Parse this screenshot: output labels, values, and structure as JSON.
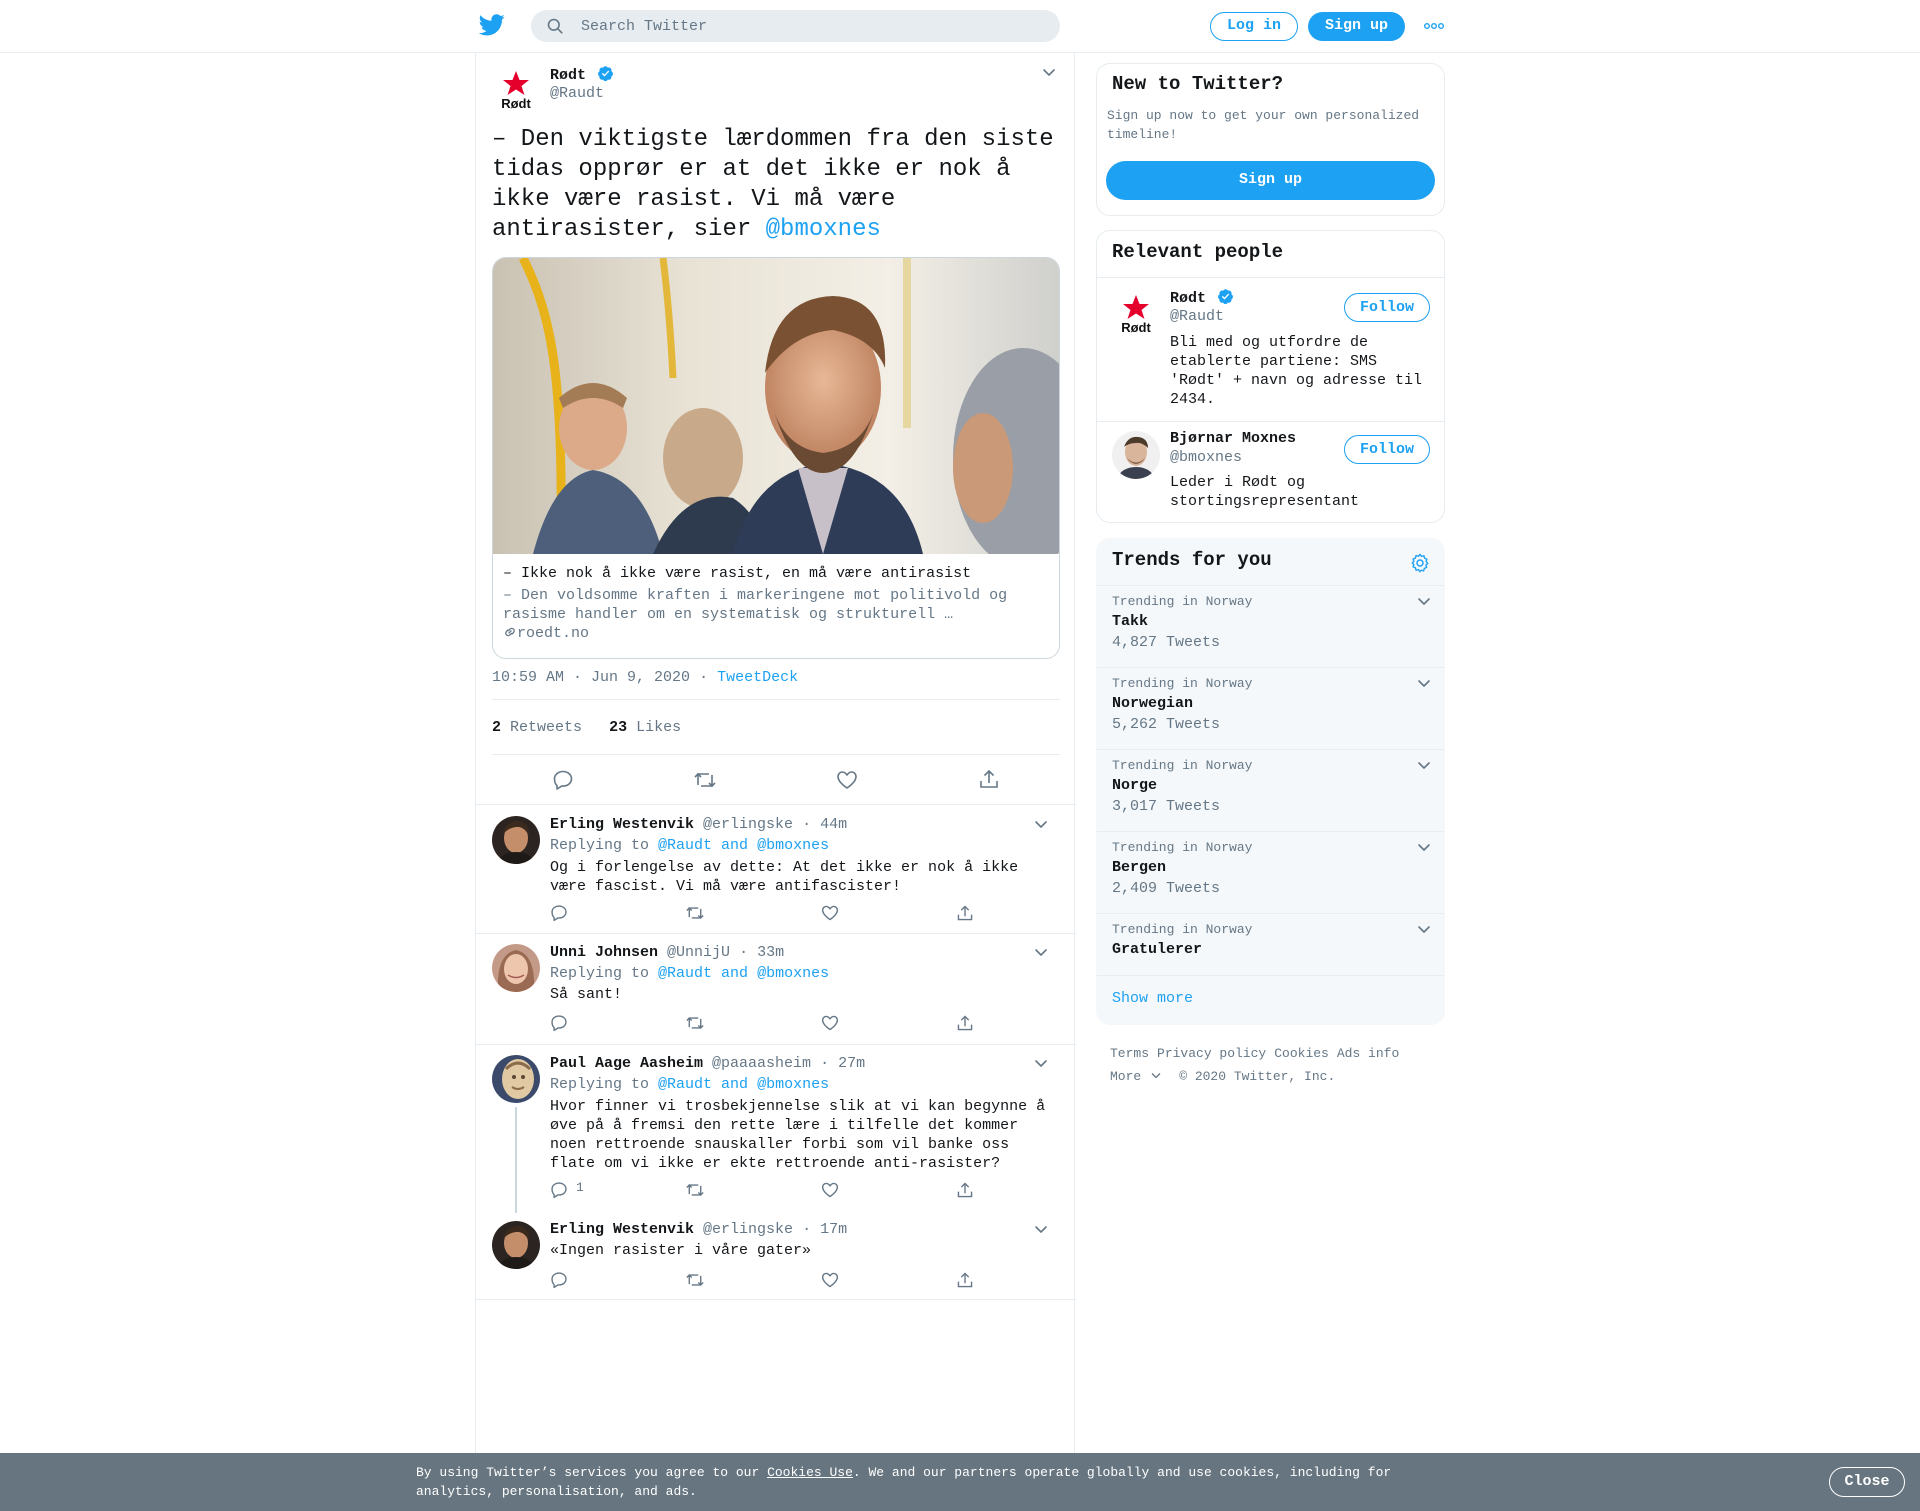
{
  "topbar": {
    "search_placeholder": "Search Twitter",
    "login_label": "Log in",
    "signup_label": "Sign up",
    "more_icon": "more-dots-icon"
  },
  "colors": {
    "accent": "#1da1f2",
    "text": "#14171a",
    "muted": "#657786",
    "border": "#e6ecf0",
    "cookie_bg": "#66757f",
    "rodt_red": "#e5002b"
  },
  "tweet": {
    "author_name": "Rødt",
    "author_handle": "@Raudt",
    "text_before": "– Den viktigste lærdommen fra den siste tidas opprør er at det ikke er nok å ikke være rasist. Vi må være antirasister, sier ",
    "text_mention": "@bmoxnes",
    "card": {
      "title": "– Ikke nok å ikke være rasist, en må være antirasist",
      "description": "– Den voldsomme kraften i markeringene mot politivold og rasisme handler om en systematisk og strukturell …",
      "domain": "roedt.no"
    },
    "time": "10:59 AM · Jun 9, 2020",
    "dot": "·",
    "source": "TweetDeck",
    "retweets_count": "2",
    "retweets_label": "Retweets",
    "likes_count": "23",
    "likes_label": "Likes"
  },
  "replies": [
    {
      "name": "Erling Westenvik",
      "handle": "@erlingske",
      "time": "· 44m",
      "replying_prefix": "Replying to",
      "replying_to": "@Raudt and @bmoxnes",
      "text": "Og i forlengelse av dette: At det ikke er nok å ikke være fascist. Vi må være antifascister!",
      "reply_count": ""
    },
    {
      "name": "Unni Johnsen",
      "handle": "@UnnijU",
      "time": "· 33m",
      "replying_prefix": "Replying to",
      "replying_to": "@Raudt and @bmoxnes",
      "text": "Så sant!",
      "reply_count": ""
    },
    {
      "name": "Paul Aage Aasheim",
      "handle": "@paaaasheim",
      "time": "· 27m",
      "replying_prefix": "Replying to",
      "replying_to": "@Raudt and @bmoxnes",
      "text": "Hvor finner vi trosbekjennelse slik at vi kan begynne å øve på å fremsi den rette lære i tilfelle det kommer noen rettroende snauskaller forbi som vil banke oss flate om vi ikke er ekte rettroende anti-rasister?",
      "reply_count": "1"
    },
    {
      "name": "Erling Westenvik",
      "handle": "@erlingske",
      "time": "· 17m",
      "text": "«Ingen rasister i våre gater»",
      "reply_count": ""
    }
  ],
  "sidebar": {
    "new_title": "New to Twitter?",
    "new_sub": "Sign up now to get your own personalized timeline!",
    "new_signup": "Sign up",
    "relevant_title": "Relevant people",
    "people": [
      {
        "name": "Rødt",
        "handle": "@Raudt",
        "bio": "Bli med og utfordre de etablerte partiene: SMS 'Rødt' + navn og adresse til 2434.",
        "follow": "Follow"
      },
      {
        "name": "Bjørnar Moxnes",
        "handle": "@bmoxnes",
        "bio": "Leder i Rødt og stortingsrepresentant",
        "follow": "Follow"
      }
    ],
    "trends_title": "Trends for you",
    "trends": [
      {
        "context": "Trending in Norway",
        "name": "Takk",
        "count": "4,827 Tweets"
      },
      {
        "context": "Trending in Norway",
        "name": "Norwegian",
        "count": "5,262 Tweets"
      },
      {
        "context": "Trending in Norway",
        "name": "Norge",
        "count": "3,017 Tweets"
      },
      {
        "context": "Trending in Norway",
        "name": "Bergen",
        "count": "2,409 Tweets"
      },
      {
        "context": "Trending in Norway",
        "name": "Gratulerer",
        "count": ""
      }
    ],
    "show_more": "Show more",
    "footer": {
      "terms": "Terms",
      "privacy": "Privacy policy",
      "cookies": "Cookies",
      "ads": "Ads info",
      "more": "More",
      "copyright": "© 2020 Twitter, Inc."
    }
  },
  "cookie_bar": {
    "text_before": "By using Twitter’s services you agree to our ",
    "link": "Cookies Use",
    "text_after": ". We and our partners operate globally and use cookies, including for analytics, personalisation, and ads.",
    "close": "Close"
  }
}
